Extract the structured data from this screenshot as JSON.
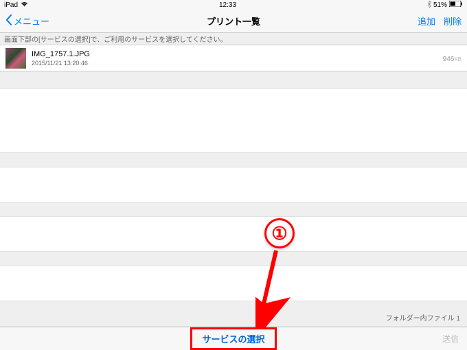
{
  "status_bar": {
    "device": "iPad",
    "time": "12:33",
    "battery_percent": "51%"
  },
  "nav": {
    "back_label": "メニュー",
    "title": "プリント一覧",
    "add": "追加",
    "delete": "削除"
  },
  "instruction": "画面下部の[サービスの選択]で、ご利用のサービスを選択してください。",
  "file": {
    "name": "IMG_1757.1.JPG",
    "date": "2015/11/21  13:20:46",
    "size": "946",
    "size_unit": "KB"
  },
  "folder_info": "フォルダー内ファイル  1",
  "bottom": {
    "service_select": "サービスの選択",
    "send": "送信"
  },
  "annotation": {
    "step": "①"
  }
}
